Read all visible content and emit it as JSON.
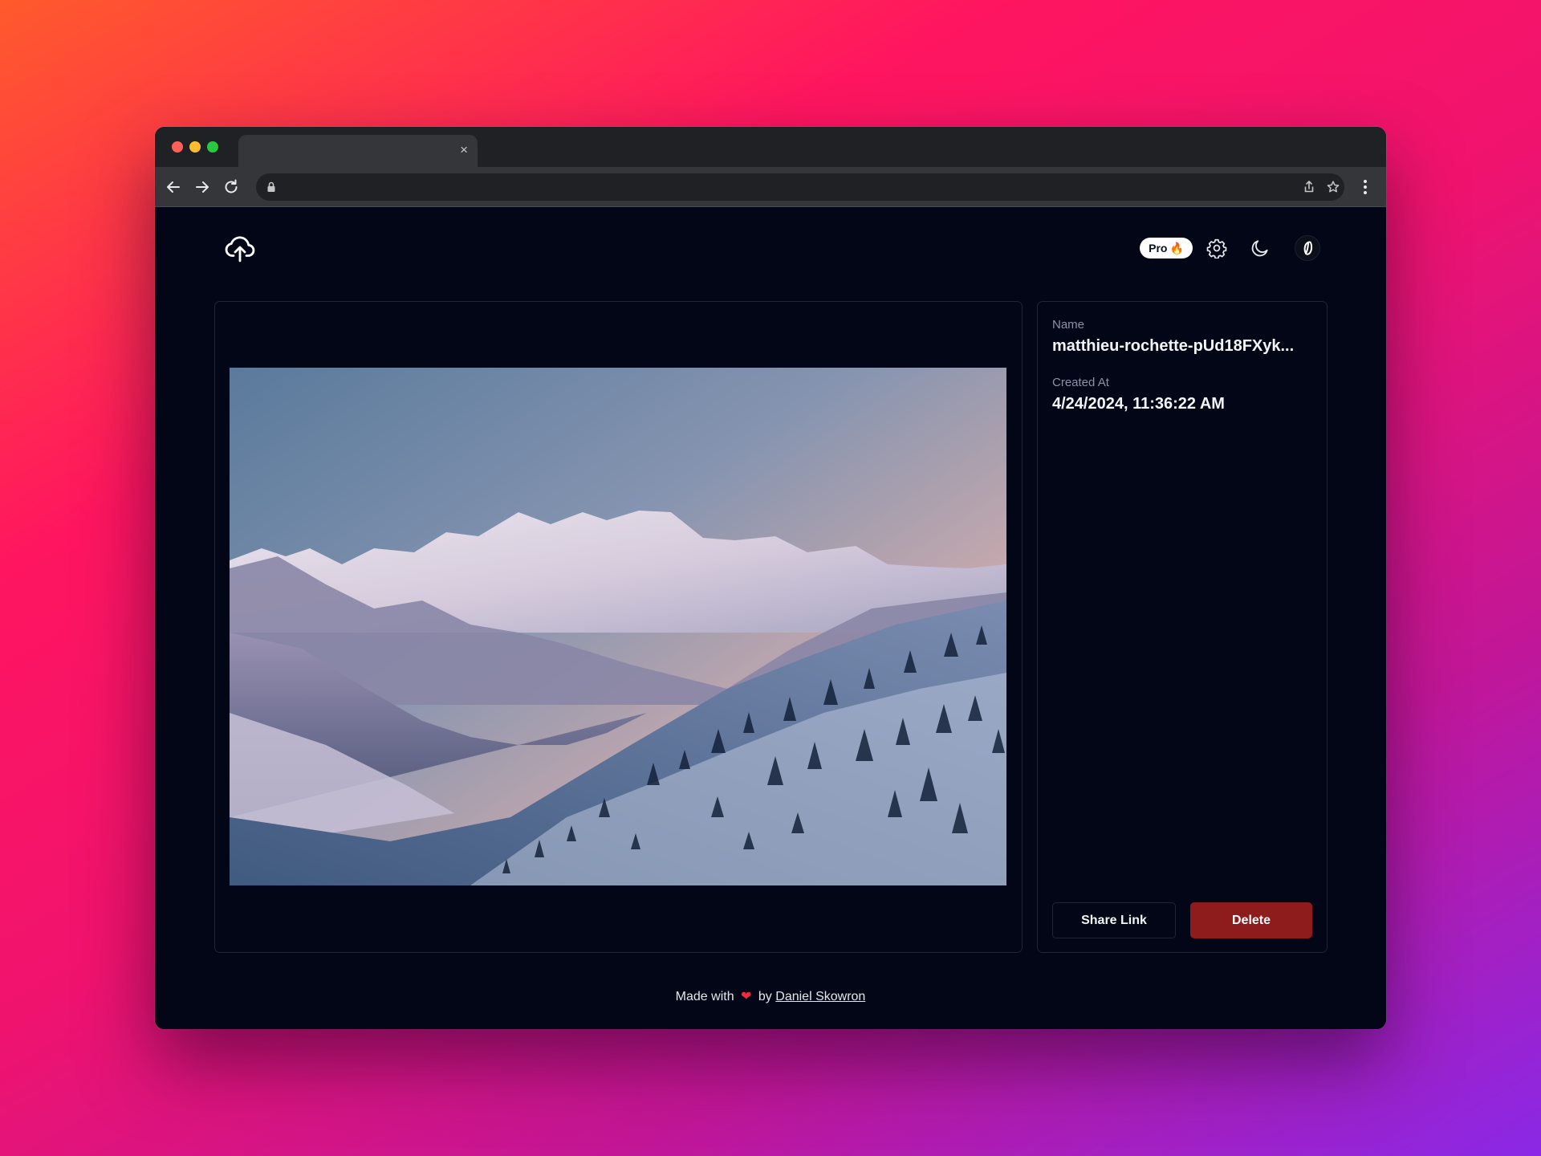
{
  "browser": {
    "tab_close_glyph": "×",
    "icons": [
      "back-arrow-icon",
      "forward-arrow-icon",
      "reload-icon",
      "lock-icon",
      "share-icon",
      "star-icon",
      "kebab-menu-icon"
    ]
  },
  "header": {
    "logo_icon": "cloud-upload-icon",
    "pro_badge": {
      "label": "Pro",
      "emoji": "🔥"
    },
    "icons": [
      "gear-icon",
      "moon-icon",
      "avatar"
    ]
  },
  "image": {
    "alt": "mountain landscape at sunset"
  },
  "details": {
    "name_label": "Name",
    "name_value": "matthieu-rochette-pUd18FXyk...",
    "created_label": "Created At",
    "created_value": "4/24/2024, 11:36:22 AM",
    "share_button": "Share Link",
    "delete_button": "Delete"
  },
  "footer": {
    "made_with": "Made with",
    "heart": "❤",
    "by": "by",
    "author": "Daniel Skowron"
  },
  "colors": {
    "page_bg": "#020617",
    "delete_bg": "#8f1c1c",
    "card_border": "#1e2535"
  }
}
